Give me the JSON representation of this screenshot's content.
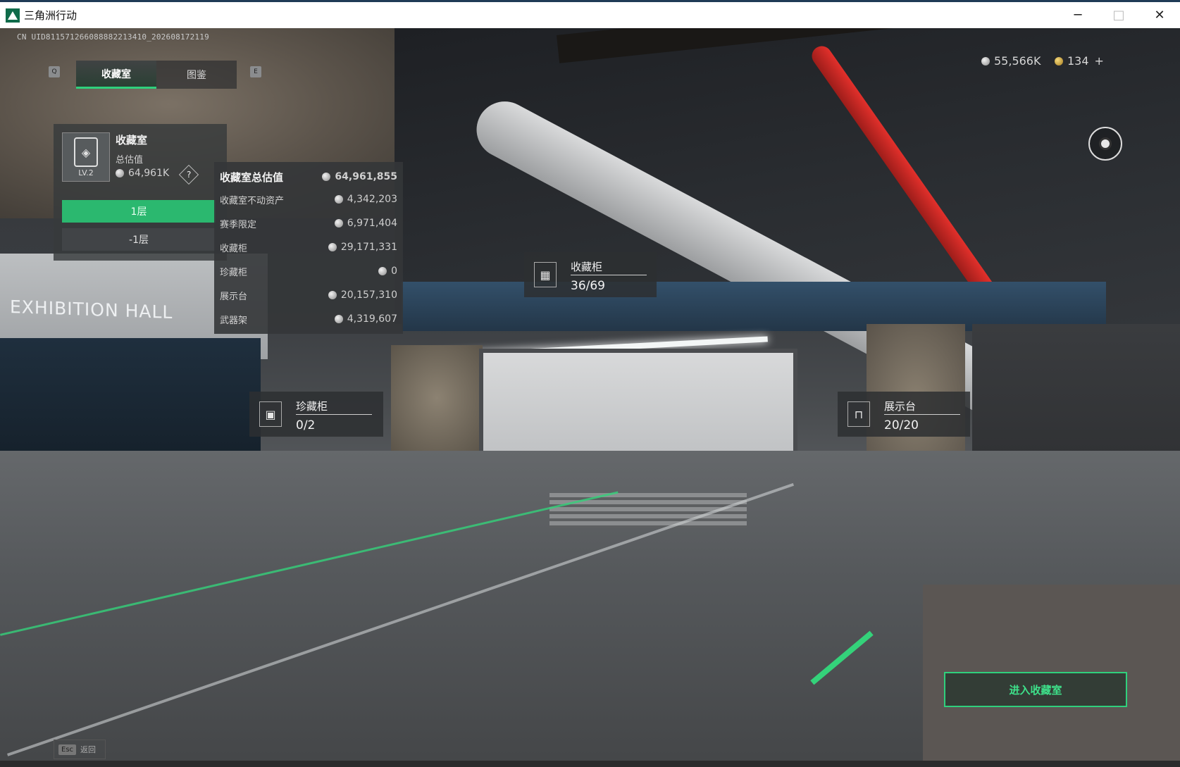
{
  "window": {
    "title": "三角洲行动",
    "minimize": "─",
    "maximize": "□",
    "close": "✕"
  },
  "uid": "CN UID811571266088882213410_202608172119",
  "tabs": {
    "left_key": "Q",
    "right_key": "E",
    "items": [
      {
        "label": "收藏室",
        "active": true
      },
      {
        "label": "图鉴",
        "active": false
      }
    ]
  },
  "currency": {
    "silver": "55,566K",
    "gold": "134",
    "add": "+"
  },
  "scene_text": {
    "hall": "EXHIBITION HALL"
  },
  "collection": {
    "title": "收藏室",
    "level": "LV.2",
    "total_label": "总估值",
    "total_value": "64,961K",
    "help": "?",
    "floors": [
      {
        "label": "1层",
        "active": true
      },
      {
        "label": "-1层",
        "active": false
      }
    ]
  },
  "breakdown": {
    "rows": [
      {
        "label": "收藏室总估值",
        "value": "64,961,855"
      },
      {
        "label": "收藏室不动资产",
        "value": "4,342,203"
      },
      {
        "label": "赛季限定",
        "value": "6,971,404"
      },
      {
        "label": "收藏柜",
        "value": "29,171,331"
      },
      {
        "label": "珍藏柜",
        "value": "0"
      },
      {
        "label": "展示台",
        "value": "20,157,310"
      },
      {
        "label": "武器架",
        "value": "4,319,607"
      }
    ]
  },
  "hotspots": {
    "cabinet": {
      "title": "收藏柜",
      "count": "36/69"
    },
    "rare": {
      "title": "珍藏柜",
      "count": "0/2"
    },
    "display": {
      "title": "展示台",
      "count": "20/20"
    }
  },
  "enter_button": "进入收藏室",
  "esc": {
    "key": "Esc",
    "label": "返回"
  },
  "colors": {
    "accent_green": "#2fd07c",
    "panel": "#37393b"
  }
}
